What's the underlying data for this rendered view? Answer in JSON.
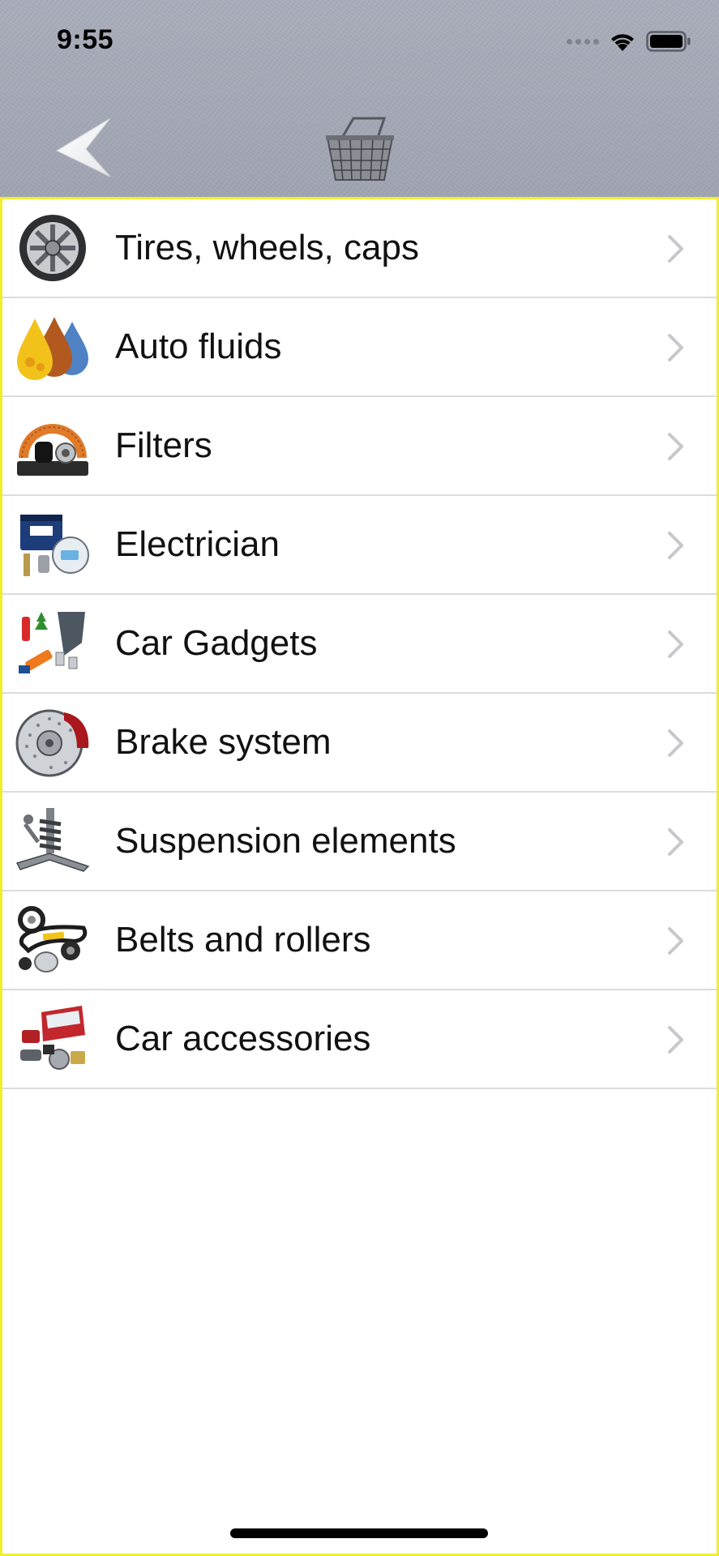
{
  "status_bar": {
    "time": "9:55"
  },
  "nav": {
    "back_icon": "back-arrow-icon",
    "basket_icon": "shopping-basket-icon"
  },
  "categories": [
    {
      "label": "Tires, wheels, caps",
      "icon": "wheel-icon"
    },
    {
      "label": "Auto fluids",
      "icon": "fluid-drops-icon"
    },
    {
      "label": "Filters",
      "icon": "filter-icon"
    },
    {
      "label": "Electrician",
      "icon": "battery-icon"
    },
    {
      "label": "Car Gadgets",
      "icon": "gadgets-icon"
    },
    {
      "label": "Brake system",
      "icon": "brake-disc-icon"
    },
    {
      "label": "Suspension elements",
      "icon": "suspension-icon"
    },
    {
      "label": "Belts and rollers",
      "icon": "belts-rollers-icon"
    },
    {
      "label": "Car accessories",
      "icon": "car-door-icon"
    }
  ],
  "colors": {
    "header_bg": "#a4a8b6",
    "frame": "#f1ee2c",
    "separator": "#dcdcdc",
    "chevron": "#c7c7cc"
  }
}
